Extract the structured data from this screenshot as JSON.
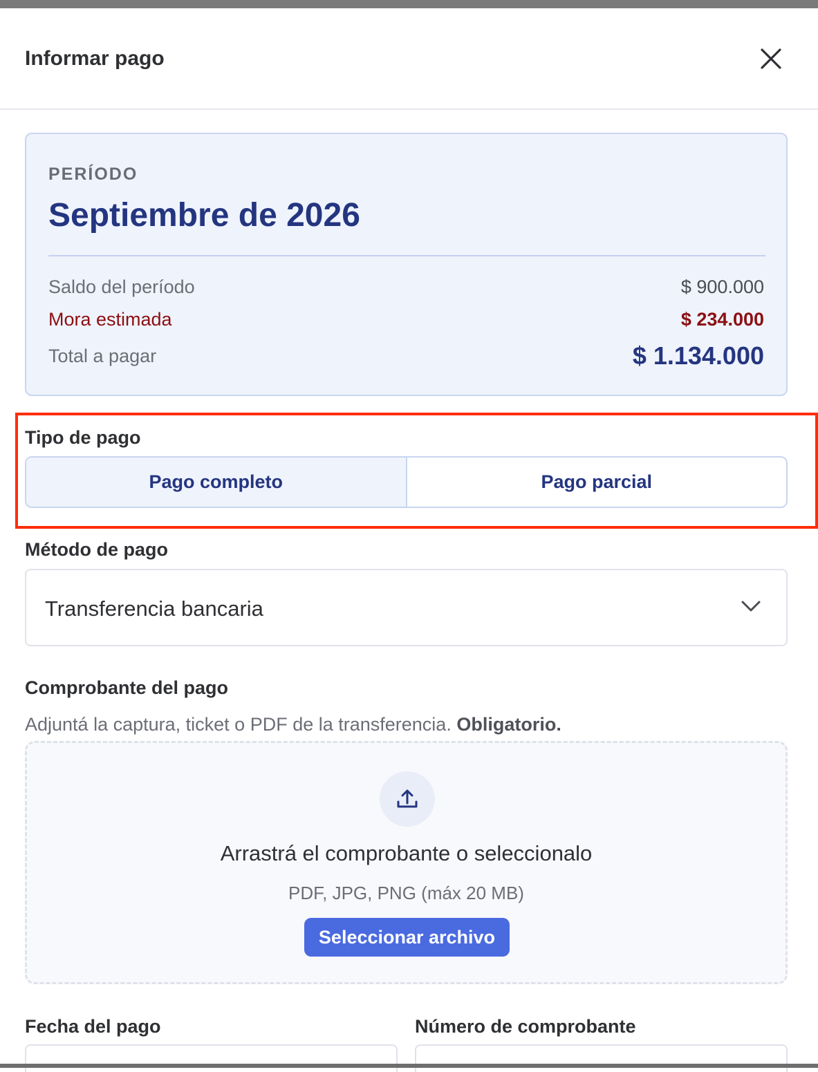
{
  "dialog": {
    "title": "Informar pago"
  },
  "summary": {
    "period_label": "PERÍODO",
    "period_value": "Septiembre de 2026",
    "rows": [
      {
        "label": "Saldo del período",
        "value": "$ 900.000"
      },
      {
        "label": "Mora estimada",
        "value": "$ 234.000"
      },
      {
        "label": "Total a pagar",
        "value": "$ 1.134.000"
      }
    ]
  },
  "payment_type": {
    "label": "Tipo de pago",
    "options": [
      "Pago completo",
      "Pago parcial"
    ],
    "selected": "Pago completo"
  },
  "payment_method": {
    "label": "Método de pago",
    "selected": "Transferencia bancaria"
  },
  "receipt": {
    "label": "Comprobante del pago",
    "help": "Adjuntá la captura, ticket o PDF de la transferencia.",
    "required": "Obligatorio.",
    "drop_title": "Arrastrá el comprobante o seleccionalo",
    "drop_sub": "PDF, JPG, PNG (máx 20 MB)",
    "button": "Seleccionar archivo"
  },
  "payment_date": {
    "label": "Fecha del pago"
  },
  "receipt_number": {
    "label": "Número de comprobante"
  },
  "colors": {
    "accent": "#4a6ae0",
    "navy": "#243580",
    "mora": "#8b0f12",
    "highlight": "#ff2d0a"
  },
  "icons": [
    "close-icon",
    "chevron-down-icon",
    "upload-icon"
  ]
}
